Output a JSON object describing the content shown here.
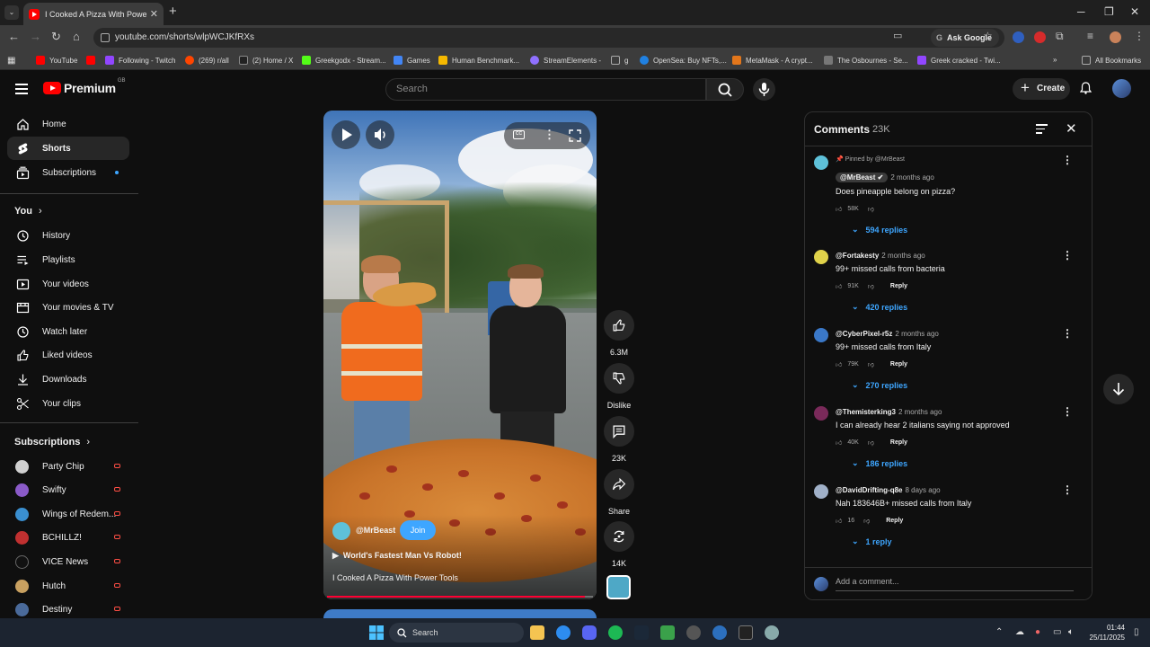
{
  "browser": {
    "tab_title": "I Cooked A Pizza With Power To",
    "url": "youtube.com/shorts/wlpWCJKfRXs",
    "ask_google": "Ask Google",
    "bookmarks": [
      {
        "label": "YouTube",
        "color": "#ff0000"
      },
      {
        "label": "",
        "color": "#ff0000"
      },
      {
        "label": "Following - Twitch",
        "color": "#9146ff"
      },
      {
        "label": "(269) r/all",
        "color": "#ff4500"
      },
      {
        "label": "(2) Home / X",
        "color": "#dddddd"
      },
      {
        "label": "Greekgodx - Stream...",
        "color": "#53fc18"
      },
      {
        "label": "Games",
        "color": "#4285f4"
      },
      {
        "label": "Human Benchmark...",
        "color": "#f5b800"
      },
      {
        "label": "StreamElements -",
        "color": "#8f70ff"
      },
      {
        "label": "g",
        "color": "#aaaaaa"
      },
      {
        "label": "OpenSea: Buy NFTs,...",
        "color": "#2081e2"
      },
      {
        "label": "MetaMask - A crypt...",
        "color": "#e2761b"
      },
      {
        "label": "The Osbournes - Se...",
        "color": "#aaaaaa"
      },
      {
        "label": "Greek cracked - Twi...",
        "color": "#9146ff"
      }
    ],
    "all_bookmarks": "All Bookmarks"
  },
  "masthead": {
    "logo_word": "Premium",
    "logo_region": "GB",
    "search_placeholder": "Search",
    "create_label": "Create"
  },
  "sidebar": {
    "main": [
      {
        "label": "Home",
        "icon": "home-icon"
      },
      {
        "label": "Shorts",
        "icon": "shorts-icon"
      },
      {
        "label": "Subscriptions",
        "icon": "subscriptions-icon"
      }
    ],
    "you_heading": "You",
    "you_items": [
      {
        "label": "History",
        "icon": "history-icon"
      },
      {
        "label": "Playlists",
        "icon": "playlists-icon"
      },
      {
        "label": "Your videos",
        "icon": "your-videos-icon"
      },
      {
        "label": "Your movies & TV",
        "icon": "movies-icon"
      },
      {
        "label": "Watch later",
        "icon": "watch-later-icon"
      },
      {
        "label": "Liked videos",
        "icon": "liked-icon"
      },
      {
        "label": "Downloads",
        "icon": "download-icon"
      },
      {
        "label": "Your clips",
        "icon": "clips-icon"
      }
    ],
    "subs_heading": "Subscriptions",
    "subs": [
      {
        "label": "Party Chip",
        "color": "#d0d0d0"
      },
      {
        "label": "Swifty",
        "color": "#8a5ac8"
      },
      {
        "label": "Wings of Redem...",
        "color": "#3a8fd0"
      },
      {
        "label": "BCHILLZ!",
        "color": "#c03030"
      },
      {
        "label": "VICE News",
        "color": "#111111"
      },
      {
        "label": "Hutch",
        "color": "#c8a060"
      },
      {
        "label": "Destiny",
        "color": "#4a6a9a"
      }
    ]
  },
  "short": {
    "channel": "@MrBeast",
    "join_label": "Join",
    "related": "World's Fastest Man Vs Robot!",
    "title": "I Cooked A Pizza With Power Tools",
    "progress": 0.97
  },
  "actions": {
    "likes": "6.3M",
    "dislike": "Dislike",
    "comments": "23K",
    "share": "Share",
    "remix": "14K"
  },
  "comments": {
    "title": "Comments",
    "count": "23K",
    "pinned_label": "Pinned by @MrBeast",
    "input_placeholder": "Add a comment...",
    "reply_label": "Reply",
    "items": [
      {
        "user": "@MrBeast",
        "time": "2 months ago",
        "text": "Does pineapple belong on pizza?",
        "likes": "58K",
        "replies": "594 replies",
        "color": "#5ec1d9"
      },
      {
        "user": "@Fortakesty",
        "time": "2 months ago",
        "text": "99+ missed calls from bacteria",
        "likes": "91K",
        "replies": "420 replies",
        "color": "#e0d24a"
      },
      {
        "user": "@CyberPixel-r5z",
        "time": "2 months ago",
        "text": "99+ missed calls from Italy",
        "likes": "79K",
        "replies": "270 replies",
        "color": "#3a78c8"
      },
      {
        "user": "@Themisterking3",
        "time": "2 months ago",
        "text": "I can already hear 2 italians saying not approved",
        "likes": "40K",
        "replies": "186 replies",
        "color": "#7a2a5a"
      },
      {
        "user": "@DavidDrifting-q8e",
        "time": "8 days ago",
        "text": "Nah 183646B+ missed calls from Italy",
        "likes": "16",
        "replies": "1 reply",
        "color": "#a0b0c8"
      }
    ]
  },
  "taskbar": {
    "search": "Search",
    "time": "01:44",
    "date": "25/11/2025"
  }
}
